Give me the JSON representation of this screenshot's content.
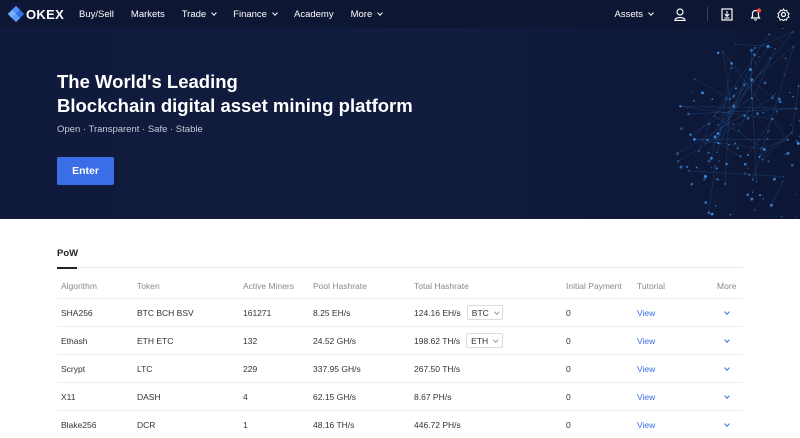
{
  "brand": {
    "name": "OKEX"
  },
  "nav": {
    "items": [
      {
        "label": "Buy/Sell",
        "has_dropdown": false
      },
      {
        "label": "Markets",
        "has_dropdown": false
      },
      {
        "label": "Trade",
        "has_dropdown": true
      },
      {
        "label": "Finance",
        "has_dropdown": true
      },
      {
        "label": "Academy",
        "has_dropdown": false
      },
      {
        "label": "More",
        "has_dropdown": true
      }
    ],
    "assets_label": "Assets",
    "icons": [
      "user-icon",
      "download-icon",
      "bell-icon",
      "settings-icon"
    ]
  },
  "hero": {
    "title_line1": "The World's Leading",
    "title_line2": "Blockchain digital asset mining platform",
    "subtitle": "Open · Transparent · Safe · Stable",
    "enter_label": "Enter"
  },
  "tabs": [
    {
      "label": "PoW",
      "active": true
    }
  ],
  "table": {
    "headers": [
      "Algorithm",
      "Token",
      "Active Miners",
      "Pool Hashrate",
      "Total Hashrate",
      "Initial Payment",
      "Tutorial",
      "More"
    ],
    "rows": [
      {
        "algorithm": "SHA256",
        "token": "BTC BCH BSV",
        "active_miners": "161271",
        "pool_hashrate": "8.25 EH/s",
        "total_hashrate": "124.16 EH/s",
        "coin_select": "BTC",
        "initial_payment": "0",
        "tutorial": "View"
      },
      {
        "algorithm": "Ethash",
        "token": "ETH ETC",
        "active_miners": "132",
        "pool_hashrate": "24.52 GH/s",
        "total_hashrate": "198.62 TH/s",
        "coin_select": "ETH",
        "initial_payment": "0",
        "tutorial": "View"
      },
      {
        "algorithm": "Scrypt",
        "token": "LTC",
        "active_miners": "229",
        "pool_hashrate": "337.95 GH/s",
        "total_hashrate": "267.50 TH/s",
        "initial_payment": "0",
        "tutorial": "View"
      },
      {
        "algorithm": "X11",
        "token": "DASH",
        "active_miners": "4",
        "pool_hashrate": "62.15 GH/s",
        "total_hashrate": "8.67 PH/s",
        "initial_payment": "0",
        "tutorial": "View"
      },
      {
        "algorithm": "Blake256",
        "token": "DCR",
        "active_miners": "1",
        "pool_hashrate": "48.16 TH/s",
        "total_hashrate": "446.72 PH/s",
        "initial_payment": "0",
        "tutorial": "View"
      }
    ]
  },
  "colors": {
    "nav_bg": "#0d1632",
    "hero_bg": "#111c3f",
    "accent": "#3a6de6",
    "globe_dot": "#3f9df7"
  }
}
